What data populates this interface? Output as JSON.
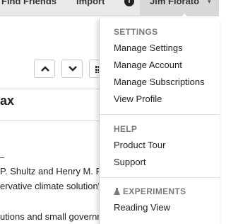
{
  "nav": {
    "find_friends": "Find Friends",
    "import": "Import",
    "info_icon": "info-icon",
    "user_name": "Jim Fiorato"
  },
  "toolbar": {
    "up_icon": "chevron-up-icon",
    "down_icon": "chevron-down-icon",
    "grid_icon": "grid-icon"
  },
  "document": {
    "title_fragment": "ax",
    "lines": [
      "P. Shultz and Henry M. P",
      "ervative climate solution\"",
      "utions and small governm"
    ]
  },
  "menu": {
    "settings": {
      "header": "SETTINGS",
      "items": [
        "Manage Settings",
        "Manage Account",
        "Manage Subscriptions",
        "View Profile"
      ]
    },
    "help": {
      "header": "HELP",
      "items": [
        "Product Tour",
        "Support"
      ]
    },
    "experiments": {
      "header": "EXPERIMENTS",
      "icon": "flask-icon",
      "items": [
        "Reading View"
      ]
    }
  },
  "colors": {
    "nav_bg": "#e9e9e9",
    "user_bg": "#d8d8d8",
    "section_header": "#7a7a7a"
  }
}
